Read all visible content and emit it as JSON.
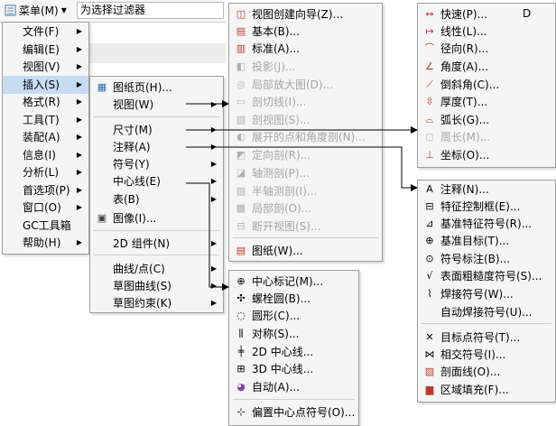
{
  "toolbar": {
    "menu_label": "菜单(M)",
    "filter_text": "为选择过滤器"
  },
  "main_menu": [
    {
      "label": "文件(F)"
    },
    {
      "label": "编辑(E)"
    },
    {
      "label": "视图(V)"
    },
    {
      "label": "插入(S)"
    },
    {
      "label": "格式(R)"
    },
    {
      "label": "工具(T)"
    },
    {
      "label": "装配(A)"
    },
    {
      "label": "信息(I)"
    },
    {
      "label": "分析(L)"
    },
    {
      "label": "首选项(P)"
    },
    {
      "label": "窗口(O)"
    },
    {
      "label": "GC工具箱"
    },
    {
      "label": "帮助(H)"
    }
  ],
  "insert_menu": [
    {
      "label": "图纸页(H)...",
      "icon": "drawing-sheet-icon"
    },
    {
      "label": "视图(W)"
    },
    {
      "label": "尺寸(M)"
    },
    {
      "label": "注释(A)"
    },
    {
      "label": "符号(Y)"
    },
    {
      "label": "中心线(E)"
    },
    {
      "label": "表(B)"
    },
    {
      "label": "图像(I)...",
      "icon": "image-icon"
    },
    {
      "label": "2D 组件(N)"
    },
    {
      "label": "曲线/点(C)"
    },
    {
      "label": "草图曲线(S)"
    },
    {
      "label": "草图约束(K)"
    }
  ],
  "view_menu": [
    {
      "label": "视图创建向导(Z)...",
      "icon": "view-wizard-icon"
    },
    {
      "label": "基本(B)...",
      "icon": "base-view-icon"
    },
    {
      "label": "标准(A)...",
      "icon": "standard-view-icon"
    },
    {
      "label": "投影(J)...",
      "icon": "projected-view-icon"
    },
    {
      "label": "局部放大图(D)...",
      "icon": "detail-view-icon"
    },
    {
      "label": "剖切线(I)...",
      "icon": "section-line-icon"
    },
    {
      "label": "剖视图(S)...",
      "icon": "section-view-icon"
    },
    {
      "label": "展开的点和角度剖(N)...",
      "icon": "unfolded-section-icon"
    },
    {
      "label": "定向剖(R)...",
      "icon": "oriented-section-icon"
    },
    {
      "label": "轴测剖(P)...",
      "icon": "pictorial-section-icon"
    },
    {
      "label": "半轴测剖(I)...",
      "icon": "half-pictorial-section-icon"
    },
    {
      "label": "局部剖(O)...",
      "icon": "break-out-section-icon"
    },
    {
      "label": "断开视图(S)...",
      "icon": "broken-view-icon"
    },
    {
      "label": "图纸(W)...",
      "icon": "drawing-icon"
    }
  ],
  "dim_menu": [
    {
      "label": "快速(P)...",
      "icon": "rapid-dim-icon"
    },
    {
      "label": "线性(L)...",
      "icon": "linear-dim-icon"
    },
    {
      "label": "径向(R)...",
      "icon": "radial-dim-icon"
    },
    {
      "label": "角度(A)...",
      "icon": "angular-dim-icon"
    },
    {
      "label": "倒斜角(C)...",
      "icon": "chamfer-dim-icon"
    },
    {
      "label": "厚度(T)...",
      "icon": "thickness-dim-icon"
    },
    {
      "label": "弧长(G)...",
      "icon": "arc-length-icon"
    },
    {
      "label": "周长(M)...",
      "icon": "perimeter-icon"
    },
    {
      "label": "坐标(O)...",
      "icon": "ordinate-icon"
    }
  ],
  "dim_menu_extra": "D",
  "annot_menu": [
    {
      "label": "注释(N)...",
      "icon": "note-icon"
    },
    {
      "label": "特征控制框(E)...",
      "icon": "feature-control-frame-icon"
    },
    {
      "label": "基准特征符号(R)...",
      "icon": "datum-feature-icon"
    },
    {
      "label": "基准目标(T)...",
      "icon": "datum-target-icon"
    },
    {
      "label": "符号标注(B)...",
      "icon": "balloon-icon"
    },
    {
      "label": "表面粗糙度符号(S)...",
      "icon": "surface-finish-icon"
    },
    {
      "label": "焊接符号(W)...",
      "icon": "weld-symbol-icon"
    },
    {
      "label": "自动焊接符号(U)...",
      "icon": ""
    },
    {
      "label": "目标点符号(T)...",
      "icon": "target-point-icon"
    },
    {
      "label": "相交符号(I)...",
      "icon": "intersection-symbol-icon"
    },
    {
      "label": "剖面线(O)...",
      "icon": "crosshatch-icon"
    },
    {
      "label": "区域填充(F)...",
      "icon": "area-fill-icon"
    }
  ],
  "cl_menu": [
    {
      "label": "中心标记(M)...",
      "icon": "center-mark-icon"
    },
    {
      "label": "螺栓圆(B)...",
      "icon": "bolt-circle-icon"
    },
    {
      "label": "圆形(C)...",
      "icon": "circular-centerline-icon"
    },
    {
      "label": "对称(S)...",
      "icon": "symmetric-centerline-icon"
    },
    {
      "label": "2D 中心线...",
      "icon": "2d-centerline-icon"
    },
    {
      "label": "3D 中心线...",
      "icon": "3d-centerline-icon"
    },
    {
      "label": "自动(A)...",
      "icon": "auto-centerline-icon"
    },
    {
      "label": "偏置中心点符号(O)...",
      "icon": "offset-center-point-icon"
    }
  ]
}
